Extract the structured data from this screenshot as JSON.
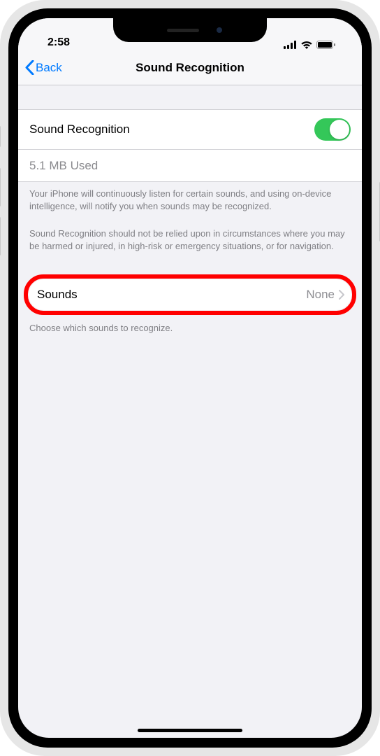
{
  "status": {
    "time": "2:58"
  },
  "nav": {
    "back": "Back",
    "title": "Sound Recognition"
  },
  "main_toggle": {
    "label": "Sound Recognition",
    "on": true
  },
  "storage": {
    "text": "5.1 MB Used"
  },
  "description": {
    "p1": "Your iPhone will continuously listen for certain sounds, and using on-device intelligence, will notify you when sounds may be recognized.",
    "p2": "Sound Recognition should not be relied upon in circumstances where you may be harmed or injured, in high-risk or emergency situations, or for navigation."
  },
  "sounds": {
    "label": "Sounds",
    "value": "None",
    "hint": "Choose which sounds to recognize."
  }
}
